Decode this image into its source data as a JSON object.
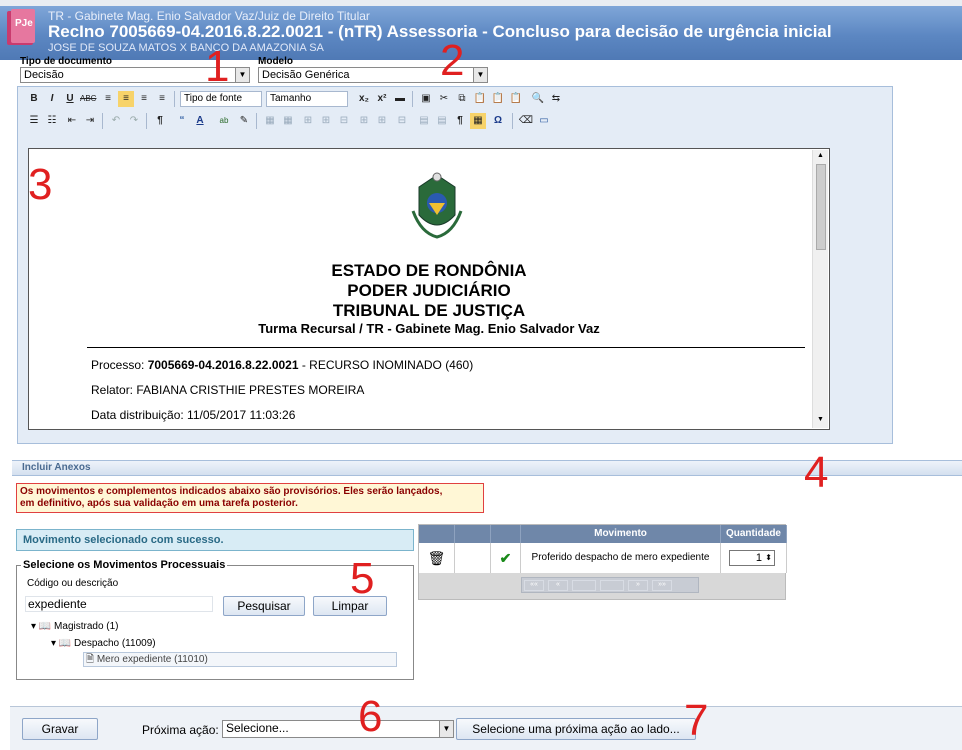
{
  "window": {
    "title_fragment": "PJe - ..."
  },
  "header": {
    "line1": "TR - Gabinete Mag. Enio Salvador Vaz/Juiz de Direito Titular",
    "line2": "RecIno 7005669-04.2016.8.22.0021 - (nTR) Assessoria - Concluso para decisão de urgência inicial",
    "line3": "JOSE DE SOUZA MATOS X BANCO DA AMAZONIA SA"
  },
  "document_type": {
    "label": "Tipo de documento",
    "value": "Decisão"
  },
  "model": {
    "label": "Modelo",
    "value": "Decisão Genérica"
  },
  "editor": {
    "font_dropdown": "Tipo de fonte",
    "size_dropdown": "Tamanho"
  },
  "document": {
    "state": "ESTADO DE RONDÔNIA",
    "power": "PODER JUDICIÁRIO",
    "court": "TRIBUNAL DE JUSTIÇA",
    "office": "Turma Recursal / TR - Gabinete Mag. Enio Salvador Vaz",
    "process_label": "Processo: ",
    "process_number": "7005669-04.2016.8.22.0021",
    "process_suffix": " - RECURSO INOMINADO (460)",
    "rapporteur": "Relator: FABIANA CRISTHIE PRESTES MOREIRA",
    "distribution": "Data distribuição: 11/05/2017 11:03:26"
  },
  "annex": {
    "title": "Incluir Anexos"
  },
  "warning": {
    "line1": "Os movimentos e complementos indicados abaixo são provisórios. Eles serão lançados,",
    "line2": "em definitivo, após sua validação em uma tarefa posterior."
  },
  "success_message": "Movimento selecionado com sucesso.",
  "movements": {
    "legend": "Selecione os Movimentos Processuais",
    "search_label": "Código ou descrição",
    "search_value": "expediente",
    "search_button": "Pesquisar",
    "clear_button": "Limpar",
    "tree": [
      {
        "label": "Magistrado (1)"
      },
      {
        "label": "Despacho (11009)"
      },
      {
        "label": "Mero expediente (11010)"
      }
    ]
  },
  "table": {
    "headers": [
      "Movimento",
      "Quantidade"
    ],
    "rows": [
      {
        "movement": "Proferido despacho de mero expediente",
        "quantity": "1"
      }
    ],
    "pager": [
      "««",
      "«",
      "»",
      "»»"
    ]
  },
  "bottom": {
    "save_button": "Gravar",
    "next_action_label": "Próxima ação:",
    "next_action_value": "Selecione...",
    "next_action_button": "Selecione uma próxima ação ao lado..."
  },
  "annotations": [
    "1",
    "2",
    "3",
    "4",
    "5",
    "6",
    "7"
  ],
  "colors": {
    "header": "#5c87c2",
    "annotation": "#e02020",
    "table_header": "#6f87a9"
  }
}
